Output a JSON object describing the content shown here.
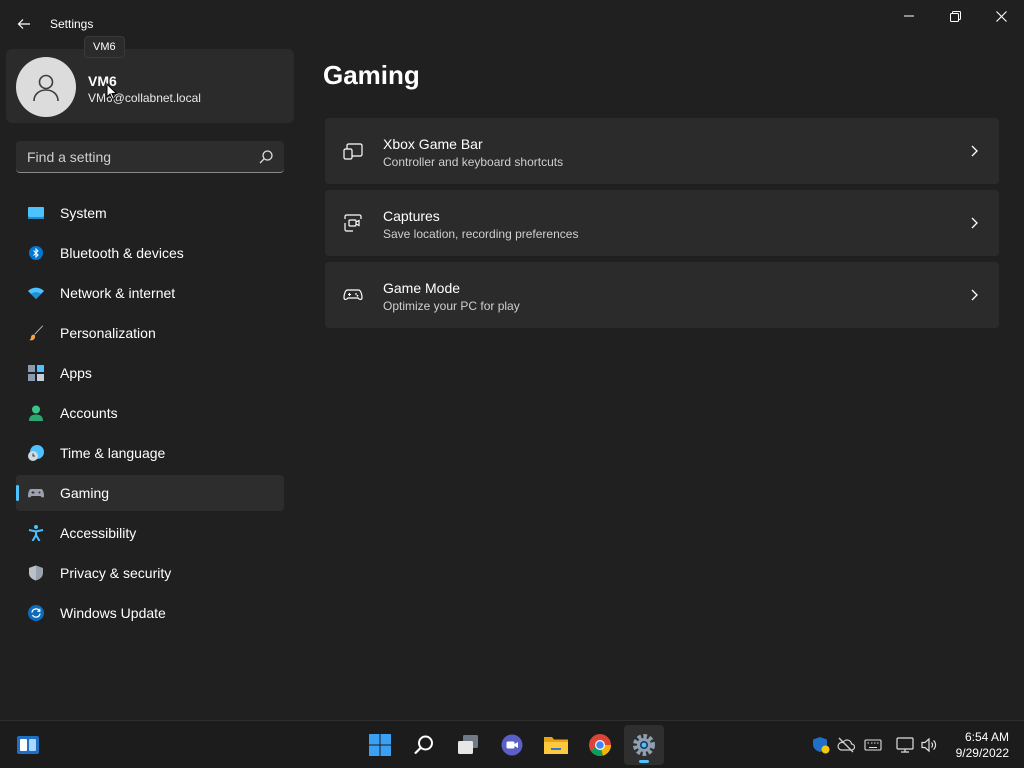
{
  "window": {
    "title": "Settings"
  },
  "tooltip": {
    "text": "VM6"
  },
  "account": {
    "name": "VM6",
    "email": "VM6@collabnet.local"
  },
  "search": {
    "placeholder": "Find a setting"
  },
  "sidebar": {
    "items": [
      {
        "label": "System",
        "icon": "system-icon"
      },
      {
        "label": "Bluetooth & devices",
        "icon": "bluetooth-icon"
      },
      {
        "label": "Network & internet",
        "icon": "wifi-icon"
      },
      {
        "label": "Personalization",
        "icon": "brush-icon"
      },
      {
        "label": "Apps",
        "icon": "apps-icon"
      },
      {
        "label": "Accounts",
        "icon": "accounts-icon"
      },
      {
        "label": "Time & language",
        "icon": "globe-clock-icon"
      },
      {
        "label": "Gaming",
        "icon": "gamepad-icon",
        "active": true
      },
      {
        "label": "Accessibility",
        "icon": "accessibility-icon"
      },
      {
        "label": "Privacy & security",
        "icon": "shield-icon"
      },
      {
        "label": "Windows Update",
        "icon": "update-icon"
      }
    ]
  },
  "main": {
    "title": "Gaming",
    "cards": [
      {
        "title": "Xbox Game Bar",
        "subtitle": "Controller and keyboard shortcuts",
        "icon": "game-bar-icon"
      },
      {
        "title": "Captures",
        "subtitle": "Save location, recording preferences",
        "icon": "capture-icon"
      },
      {
        "title": "Game Mode",
        "subtitle": "Optimize your PC for play",
        "icon": "controller-icon"
      }
    ]
  },
  "taskbar": {
    "apps": [
      "widgets-icon",
      "start-icon",
      "search-icon",
      "task-view-icon",
      "teams-chat-icon",
      "file-explorer-icon",
      "chrome-icon",
      "settings-icon"
    ],
    "active_app": "settings-icon",
    "tray": [
      "windows-security-icon",
      "onedrive-offline-icon",
      "keyboard-icon",
      "network-icon",
      "volume-icon"
    ],
    "time": "6:54 AM",
    "date": "9/29/2022"
  },
  "colors": {
    "accent": "#4cc2ff",
    "background": "#202020",
    "card": "#2b2b2b"
  }
}
